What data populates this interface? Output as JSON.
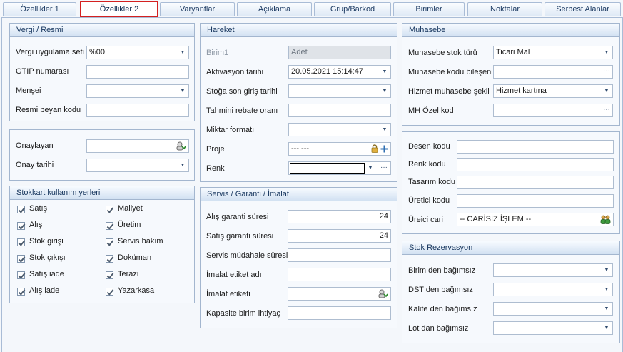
{
  "tabs": [
    "Özellikler 1",
    "Özellikler 2",
    "Varyantlar",
    "Açıklama",
    "Grup/Barkod",
    "Birimler",
    "Noktalar",
    "Serbest Alanlar"
  ],
  "vergi": {
    "title": "Vergi / Resmi",
    "rows": [
      {
        "label": "Vergi uygulama seti",
        "value": "%00"
      },
      {
        "label": "GTIP numarası",
        "value": ""
      },
      {
        "label": "Menşei",
        "value": ""
      },
      {
        "label": "Resmi beyan kodu",
        "value": ""
      }
    ]
  },
  "onay": {
    "onaylayan_label": "Onaylayan",
    "onaylayan_value": "",
    "tarih_label": "Onay tarihi",
    "tarih_value": ""
  },
  "stokkart": {
    "title": "Stokkart kullanım yerleri",
    "left": [
      "Satış",
      "Alış",
      "Stok girişi",
      "Stok çıkışı",
      "Satış iade",
      "Alış iade"
    ],
    "right": [
      "Maliyet",
      "Üretim",
      "Servis bakım",
      "Doküman",
      "Terazi",
      "Yazarkasa"
    ]
  },
  "hareket": {
    "title": "Hareket",
    "rows": [
      {
        "label": "Birim1",
        "value": "Adet"
      },
      {
        "label": "Aktivasyon tarihi",
        "value": "20.05.2021 15:14:47"
      },
      {
        "label": "Stoğa son giriş tarihi",
        "value": ""
      },
      {
        "label": "Tahmini rebate oranı",
        "value": ""
      },
      {
        "label": "Miktar formatı",
        "value": ""
      },
      {
        "label": "Proje",
        "value": "--- ---"
      },
      {
        "label": "Renk",
        "value": ""
      }
    ]
  },
  "servis": {
    "title": "Servis / Garanti / İmalat",
    "rows": [
      {
        "label": "Alış garanti süresi",
        "value": "24"
      },
      {
        "label": "Satış garanti süresi",
        "value": "24"
      },
      {
        "label": "Servis müdahale süresi",
        "value": ""
      },
      {
        "label": "İmalat etiket adı",
        "value": ""
      },
      {
        "label": "İmalat etiketi",
        "value": ""
      },
      {
        "label": "Kapasite birim ihtiyaç",
        "value": ""
      }
    ]
  },
  "muhasebe": {
    "title": "Muhasebe",
    "rows": [
      {
        "label": "Muhasebe stok türü",
        "value": "Ticari Mal"
      },
      {
        "label": "Muhasebe kodu bileşeni",
        "value": ""
      },
      {
        "label": "Hizmet muhasebe şekli",
        "value": "Hizmet kartına"
      },
      {
        "label": "MH Özel kod",
        "value": ""
      }
    ]
  },
  "desen": {
    "rows": [
      {
        "label": "Desen kodu",
        "value": ""
      },
      {
        "label": "Renk kodu",
        "value": ""
      },
      {
        "label": "Tasarım kodu",
        "value": ""
      },
      {
        "label": "Üretici kodu",
        "value": ""
      },
      {
        "label": "Üreici cari",
        "value": "-- CARİSİZ İŞLEM --"
      }
    ]
  },
  "rezervasyon": {
    "title": "Stok Rezervasyon",
    "rows": [
      {
        "label": "Birim den bağımsız",
        "value": ""
      },
      {
        "label": "DST den bağımsız",
        "value": ""
      },
      {
        "label": "Kalite den bağımsız",
        "value": ""
      },
      {
        "label": "Lot dan bağımsız",
        "value": ""
      }
    ]
  },
  "colors": {
    "active_tab_border": "#d42020",
    "panel_header": "#d2e1f2"
  }
}
